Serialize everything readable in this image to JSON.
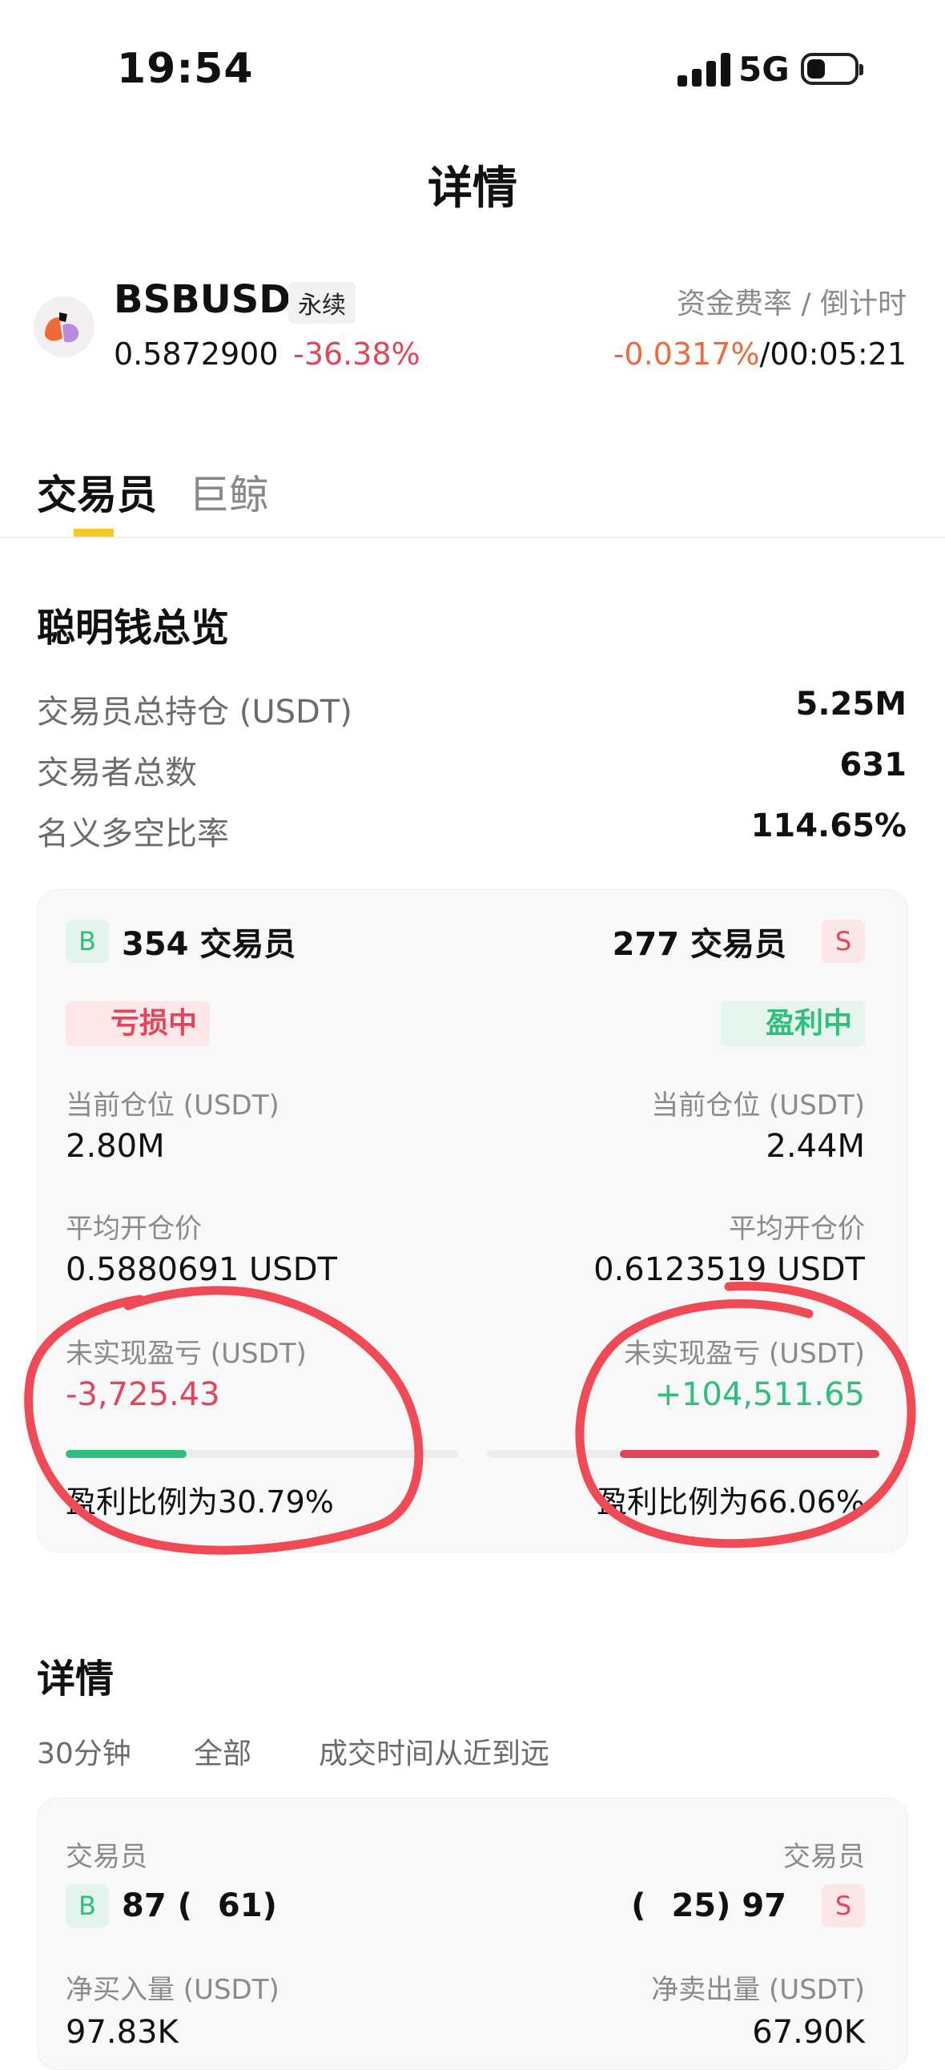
{
  "status_bar": {
    "time": "19:54",
    "network": "5G"
  },
  "nav": {
    "title": "详情"
  },
  "ticker": {
    "symbol": "BSBUSDT",
    "tag": "永续",
    "price": "0.5872900",
    "change": "-36.38%",
    "funding_label": "资金费率 / 倒计时",
    "funding_rate": "-0.0317%",
    "separator": "/",
    "countdown": "00:05:21"
  },
  "tabs": [
    {
      "label": "交易员",
      "active": true
    },
    {
      "label": "巨鲸",
      "active": false
    }
  ],
  "overview": {
    "title": "聪明钱总览",
    "rows": [
      {
        "label": "交易员总持仓 (USDT)",
        "value": "5.25M"
      },
      {
        "label": "交易者总数",
        "value": "631"
      },
      {
        "label": "名义多空比率",
        "value": "114.65%"
      }
    ]
  },
  "compare": {
    "buy": {
      "badge": "B",
      "traders": "354 交易员",
      "status": "亏损中",
      "position_label": "当前仓位 (USDT)",
      "position": "2.80M",
      "avg_price_label": "平均开仓价",
      "avg_price": "0.5880691 USDT",
      "pnl_label": "未实现盈亏 (USDT)",
      "pnl": "-3,725.43",
      "profit_ratio": "盈利比例为30.79%",
      "profit_ratio_value": 0.3079
    },
    "sell": {
      "badge": "S",
      "traders": "277 交易员",
      "status": "盈利中",
      "position_label": "当前仓位 (USDT)",
      "position": "2.44M",
      "avg_price_label": "平均开仓价",
      "avg_price": "0.6123519 USDT",
      "pnl_label": "未实现盈亏 (USDT)",
      "pnl": "+104,511.65",
      "profit_ratio": "盈利比例为66.06%",
      "profit_ratio_value": 0.6606
    }
  },
  "details": {
    "title": "详情",
    "filters": [
      "30分钟",
      "全部",
      "成交时间从近到远"
    ],
    "buy": {
      "label": "交易员",
      "badge": "B",
      "count": "87",
      "sub": "61",
      "flow_label": "净买入量 (USDT)",
      "flow": "97.83K"
    },
    "sell": {
      "label": "交易员",
      "badge": "S",
      "count": "97",
      "sub": "25",
      "flow_label": "净卖出量 (USDT)",
      "flow": "67.90K"
    }
  },
  "colors": {
    "green": "#2fbf7d",
    "red": "#e2455a",
    "orange": "#ef6a3a",
    "tab_indicator": "#f5c922",
    "annotation": "#ef4a55"
  }
}
